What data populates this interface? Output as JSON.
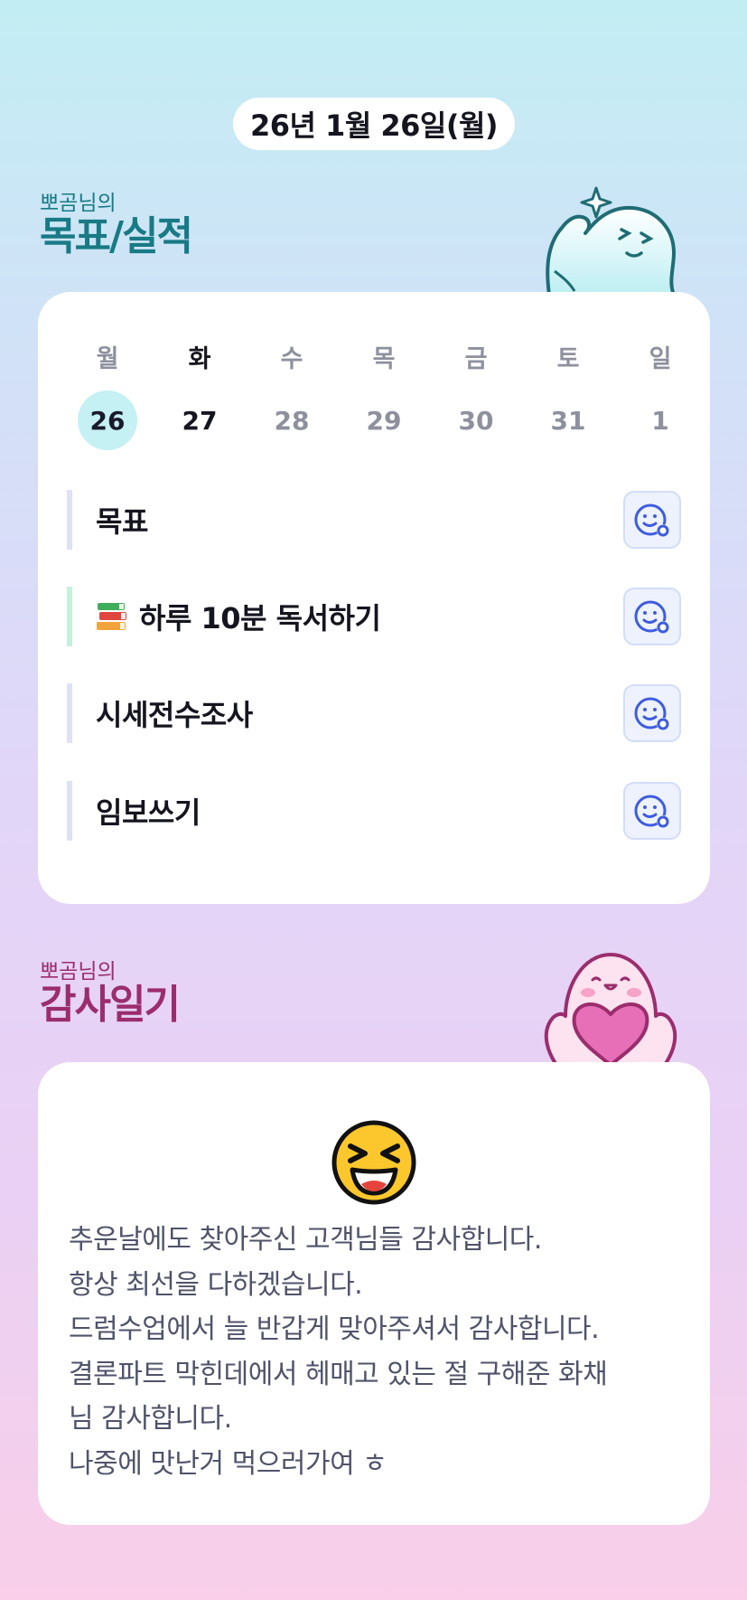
{
  "header": {
    "date": "26년 1월 26일(월)"
  },
  "goals_section": {
    "owner": "뽀곰님의",
    "title": "목표/실적"
  },
  "week": [
    {
      "dow": "월",
      "day": "26",
      "selected": true
    },
    {
      "dow": "화",
      "day": "27",
      "today": true
    },
    {
      "dow": "수",
      "day": "28"
    },
    {
      "dow": "목",
      "day": "29"
    },
    {
      "dow": "금",
      "day": "30"
    },
    {
      "dow": "토",
      "day": "31"
    },
    {
      "dow": "일",
      "day": "1"
    }
  ],
  "goals": [
    {
      "text": "목표",
      "bar": "lavender"
    },
    {
      "text": "하루 10분 독서하기",
      "icon": "books-icon",
      "bar": "green"
    },
    {
      "text": "시세전수조사",
      "bar": "lavender"
    },
    {
      "text": "임보쓰기",
      "bar": "lavender"
    }
  ],
  "thanks_section": {
    "owner": "뽀곰님의",
    "title": "감사일기",
    "mood_icon": "laughing-face-icon",
    "text": "추운날에도 찾아주신 고객님들 감사합니다.\n항상 최선을 다하겠습니다.\n드럼수업에서 늘 반갑게 맞아주셔서 감사합니다.\n결론파트 막힌데에서 헤매고 있는 절 구해준 화채\n님 감사합니다.\n나중에 맛난거 먹으러가여 ㅎ"
  },
  "colors": {
    "goals_title": "#187a85",
    "thanks_title": "#9b2d6d",
    "selected_day": "#c5f0f4",
    "smile_icon": "#3d5ce0"
  }
}
